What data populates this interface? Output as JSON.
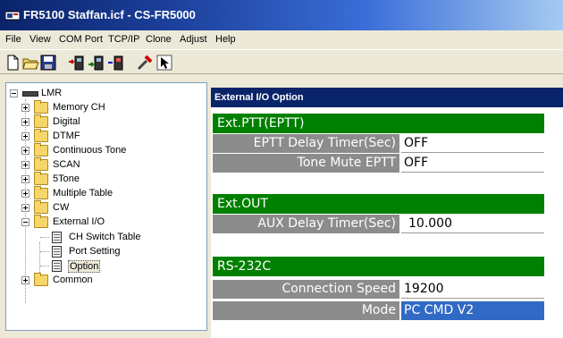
{
  "window": {
    "title": "FR5100 Staffan.icf - CS-FR5000"
  },
  "menu": [
    "File",
    "View",
    "COM Port",
    "TCP/IP",
    "Clone",
    "Adjust",
    "Help"
  ],
  "toolbar": {
    "buttons": [
      "new-file-icon",
      "open-folder-icon",
      "save-disk-icon",
      "com-read-icon",
      "com-write-icon",
      "com-clone-icon",
      "adjust-icon",
      "help-pointer-icon"
    ]
  },
  "tree": {
    "root": "LMR",
    "items": [
      {
        "label": "Memory CH",
        "expanded": false
      },
      {
        "label": "Digital",
        "expanded": false
      },
      {
        "label": "DTMF",
        "expanded": false
      },
      {
        "label": "Continuous Tone",
        "expanded": false
      },
      {
        "label": "SCAN",
        "expanded": false
      },
      {
        "label": "5Tone",
        "expanded": false
      },
      {
        "label": "Multiple Table",
        "expanded": false
      },
      {
        "label": "CW",
        "expanded": false
      },
      {
        "label": "External I/O",
        "expanded": true
      }
    ],
    "children": [
      "CH Switch Table",
      "Port Setting",
      "Option"
    ],
    "last": "Common",
    "selected": "Option"
  },
  "panel": {
    "header": "External I/O Option",
    "sections": [
      {
        "title": "Ext.PTT(EPTT)",
        "rows": [
          {
            "label": "EPTT Delay Timer(Sec)",
            "value": "OFF"
          },
          {
            "label": "Tone Mute EPTT",
            "value": "OFF"
          }
        ]
      },
      {
        "title": "Ext.OUT",
        "rows": [
          {
            "label": "AUX Delay Timer(Sec)",
            "value": "10.000"
          }
        ]
      },
      {
        "title": "RS-232C",
        "rows": [
          {
            "label": "Connection Speed",
            "value": "19200"
          },
          {
            "label": "Mode",
            "value": "PC CMD V2"
          }
        ]
      }
    ]
  },
  "colors": {
    "title_bar": "#0a246a",
    "section_green": "#008000",
    "label_gray": "#8c8c8c",
    "selection_blue": "#316ac5"
  }
}
